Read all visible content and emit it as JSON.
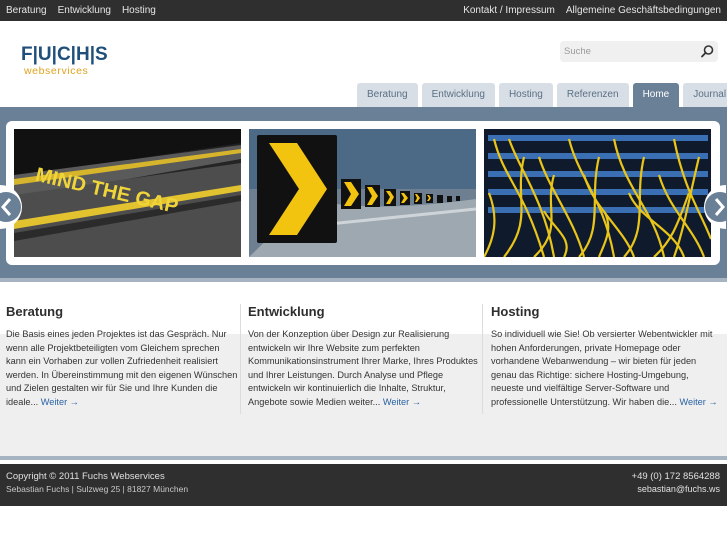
{
  "topbar": {
    "left_links": [
      "Beratung",
      "Entwicklung",
      "Hosting"
    ],
    "right_links": [
      "Kontakt / Impressum",
      "Allgemeine Geschäftsbedingungen"
    ]
  },
  "logo": {
    "line1": "F|U|C|H|S",
    "line2": "webservices"
  },
  "search": {
    "placeholder": "Suche",
    "value": ""
  },
  "tabs": [
    {
      "label": "Beratung",
      "active": false
    },
    {
      "label": "Entwicklung",
      "active": false
    },
    {
      "label": "Hosting",
      "active": false
    },
    {
      "label": "Referenzen",
      "active": false
    },
    {
      "label": "Home",
      "active": true
    },
    {
      "label": "Journal",
      "active": false
    }
  ],
  "slider": {
    "slides": [
      {
        "caption_text": "MIND THE GAP"
      },
      {
        "caption_text": ""
      },
      {
        "caption_text": ""
      }
    ]
  },
  "columns": [
    {
      "title": "Beratung",
      "text": "Die Basis eines jeden Projektes ist das Gespräch. Nur wenn alle Projektbeteiligten vom Gleichem sprechen kann ein Vorhaben zur vollen Zufriedenheit realisiert werden. In Übereinstimmung mit den eigenen Wünschen und Zielen gestalten wir für Sie und Ihre Kunden die ideale...",
      "more": "Weiter →"
    },
    {
      "title": "Entwicklung",
      "text": "Von der Konzeption über Design zur Realisierung entwickeln wir Ihre Website zum perfekten Kommunikationsinstrument Ihrer Marke, Ihres Produktes und Ihrer Leistungen. Durch Analyse und Pflege entwickeln wir kontinuierlich die Inhalte, Struktur, Angebote sowie Medien weiter...",
      "more": "Weiter →"
    },
    {
      "title": "Hosting",
      "text": "So individuell wie Sie! Ob versierter Webentwickler mit hohen Anforderungen, private Homepage oder vorhandene Webanwendung – wir bieten für jeden genau das Richtige: sichere Hosting-Umgebung, neueste und vielfältige Server-Software und professionelle Unterstützung. Wir haben die...",
      "more": "Weiter →"
    }
  ],
  "footer": {
    "copyright": "Copyright © 2011 Fuchs Webservices",
    "address": "Sebastian Fuchs | Sulzweg 25 | 81827 München",
    "phone": "+49 (0) 172 8564288",
    "email": "sebastian@fuchs.ws"
  },
  "colors": {
    "topbar": "#2f2f2f",
    "tab": "#d8dee5",
    "tab_active": "#6a8097",
    "logo_blue": "#1f4f7a",
    "logo_orange": "#e0a21c",
    "link": "#2a62a4"
  }
}
